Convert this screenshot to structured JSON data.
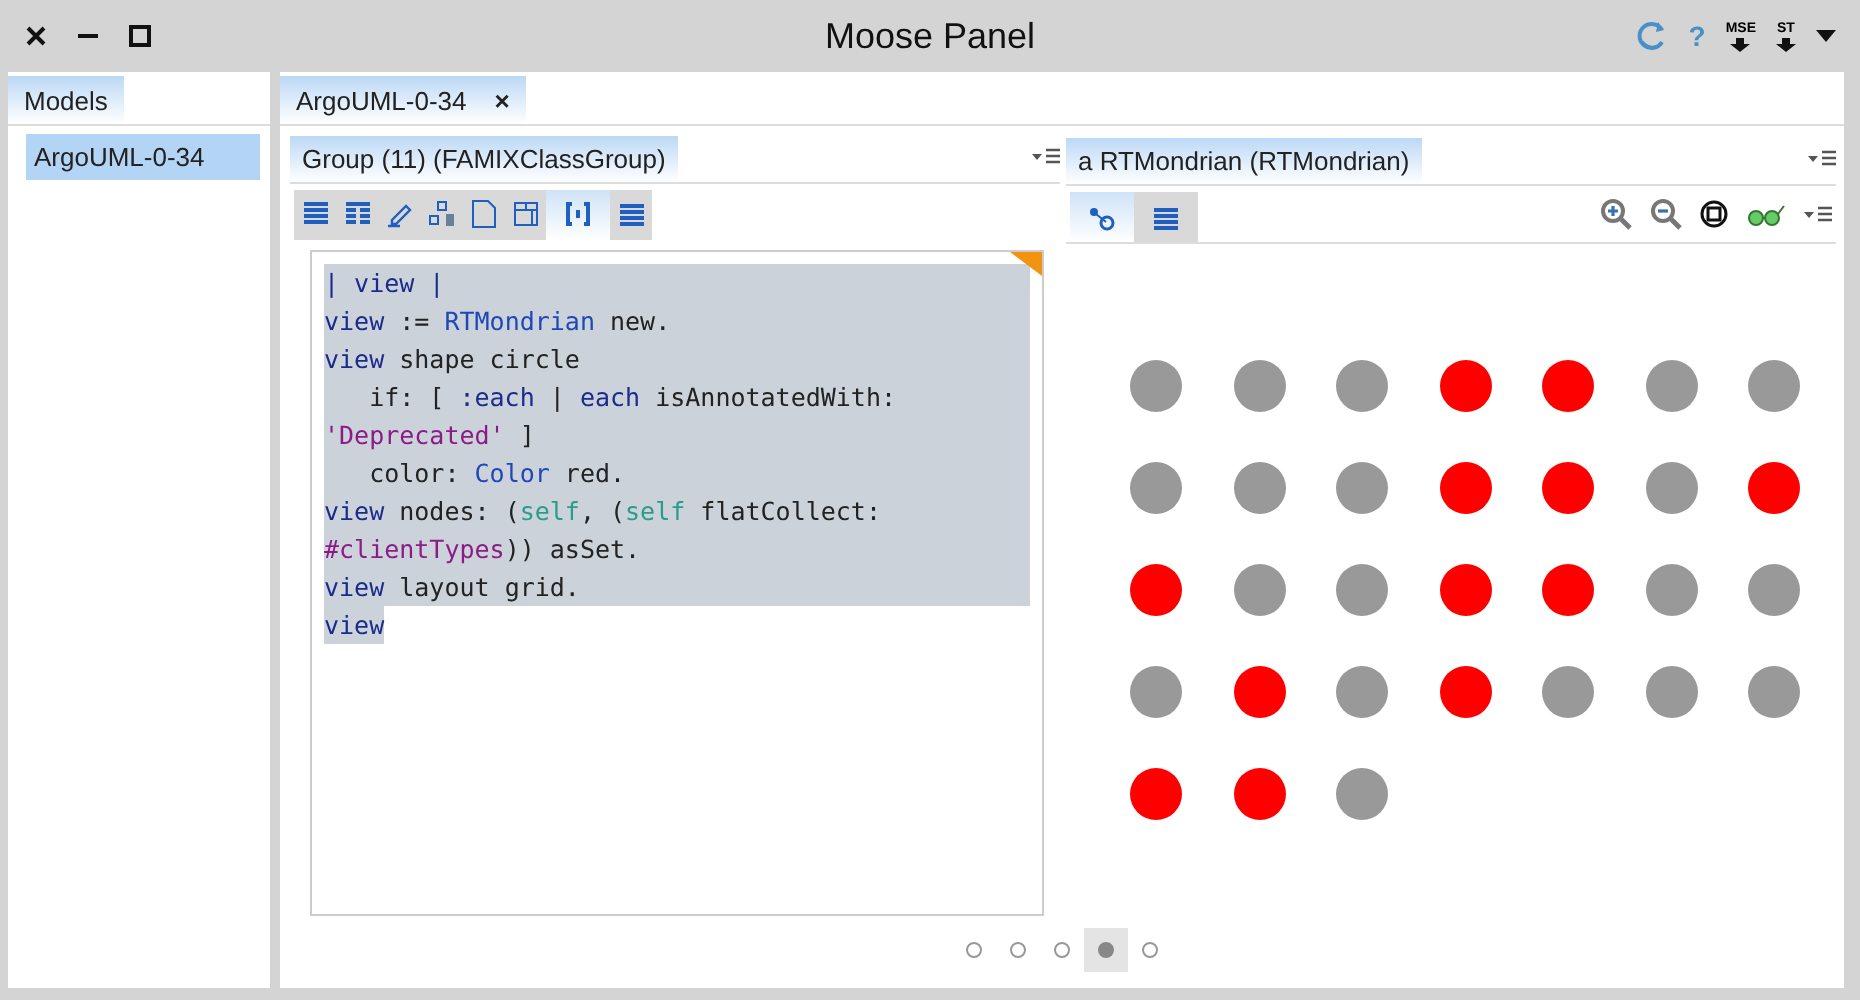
{
  "window": {
    "title": "Moose Panel"
  },
  "title_actions": [
    {
      "kind": "refresh"
    },
    {
      "kind": "help",
      "label": "?"
    },
    {
      "kind": "import",
      "label": "MSE"
    },
    {
      "kind": "import",
      "label": "ST"
    },
    {
      "kind": "menu"
    }
  ],
  "models_panel": {
    "tab": {
      "label": "Models",
      "selected": true
    },
    "items": [
      {
        "label": "ArgoUML-0-34",
        "selected": true
      }
    ]
  },
  "browser_tab": {
    "label": "ArgoUML-0-34",
    "close": "×",
    "selected": true
  },
  "left_pane": {
    "title": "Group (11) (FAMIXClassGroup)",
    "views": [
      {
        "kind": "list",
        "selected": false
      },
      {
        "kind": "table",
        "selected": false
      },
      {
        "kind": "pen",
        "selected": false
      },
      {
        "kind": "tree",
        "selected": false
      },
      {
        "kind": "page",
        "selected": false
      },
      {
        "kind": "grid",
        "selected": false
      },
      {
        "kind": "brackets",
        "selected": true
      },
      {
        "kind": "lines",
        "selected": false
      }
    ],
    "code": [
      {
        "selected": true,
        "segments": [
          {
            "text": "| view |",
            "kind": "var"
          }
        ]
      },
      {
        "selected": true,
        "segments": [
          {
            "text": "view",
            "kind": "var"
          },
          {
            "text": " := ",
            "kind": "plain"
          },
          {
            "text": "RTMondrian",
            "kind": "class"
          },
          {
            "text": " new.",
            "kind": "plain"
          }
        ]
      },
      {
        "selected": true,
        "segments": [
          {
            "text": "view",
            "kind": "var"
          },
          {
            "text": " shape circle",
            "kind": "plain"
          }
        ]
      },
      {
        "selected": true,
        "segments": [
          {
            "text": "   if: [ ",
            "kind": "plain"
          },
          {
            "text": ":each",
            "kind": "var"
          },
          {
            "text": " | ",
            "kind": "plain"
          },
          {
            "text": "each",
            "kind": "var"
          },
          {
            "text": " isAnnotatedWith:",
            "kind": "plain"
          }
        ]
      },
      {
        "selected": true,
        "segments": [
          {
            "text": "'Deprecated'",
            "kind": "symbol"
          },
          {
            "text": " ]",
            "kind": "plain"
          }
        ]
      },
      {
        "selected": true,
        "segments": [
          {
            "text": "   color: ",
            "kind": "plain"
          },
          {
            "text": "Color",
            "kind": "class"
          },
          {
            "text": " red.",
            "kind": "plain"
          }
        ]
      },
      {
        "selected": true,
        "segments": [
          {
            "text": "view",
            "kind": "var"
          },
          {
            "text": " nodes: (",
            "kind": "plain"
          },
          {
            "text": "self",
            "kind": "self"
          },
          {
            "text": ", (",
            "kind": "plain"
          },
          {
            "text": "self",
            "kind": "self"
          },
          {
            "text": " flatCollect:",
            "kind": "plain"
          }
        ]
      },
      {
        "selected": true,
        "segments": [
          {
            "text": "#clientTypes",
            "kind": "symbol"
          },
          {
            "text": ")) asSet.",
            "kind": "plain"
          }
        ]
      },
      {
        "selected": true,
        "segments": [
          {
            "text": "view",
            "kind": "var"
          },
          {
            "text": " layout grid.",
            "kind": "plain"
          }
        ]
      },
      {
        "selected": true,
        "segments": [
          {
            "text": "view",
            "kind": "var"
          }
        ]
      }
    ]
  },
  "right_pane": {
    "title": "a RTMondrian (RTMondrian)",
    "views": [
      {
        "kind": "graph",
        "selected": true
      },
      {
        "kind": "lines",
        "selected": false
      }
    ],
    "tools": [
      {
        "kind": "zoom-in"
      },
      {
        "kind": "zoom-out"
      },
      {
        "kind": "fit"
      },
      {
        "kind": "glasses"
      }
    ],
    "nodes": [
      {
        "color": "#999999"
      },
      {
        "color": "#999999"
      },
      {
        "color": "#999999"
      },
      {
        "color": "#ff0000"
      },
      {
        "color": "#ff0000"
      },
      {
        "color": "#999999"
      },
      {
        "color": "#999999"
      },
      {
        "color": "#999999"
      },
      {
        "color": "#999999"
      },
      {
        "color": "#999999"
      },
      {
        "color": "#ff0000"
      },
      {
        "color": "#ff0000"
      },
      {
        "color": "#999999"
      },
      {
        "color": "#ff0000"
      },
      {
        "color": "#ff0000"
      },
      {
        "color": "#999999"
      },
      {
        "color": "#999999"
      },
      {
        "color": "#ff0000"
      },
      {
        "color": "#ff0000"
      },
      {
        "color": "#999999"
      },
      {
        "color": "#999999"
      },
      {
        "color": "#999999"
      },
      {
        "color": "#ff0000"
      },
      {
        "color": "#999999"
      },
      {
        "color": "#ff0000"
      },
      {
        "color": "#999999"
      },
      {
        "color": "#999999"
      },
      {
        "color": "#999999"
      },
      {
        "color": "#ff0000"
      },
      {
        "color": "#ff0000"
      },
      {
        "color": "#999999"
      }
    ]
  },
  "pager": [
    {
      "selected": false
    },
    {
      "selected": false
    },
    {
      "selected": false
    },
    {
      "selected": true
    },
    {
      "selected": false
    }
  ]
}
